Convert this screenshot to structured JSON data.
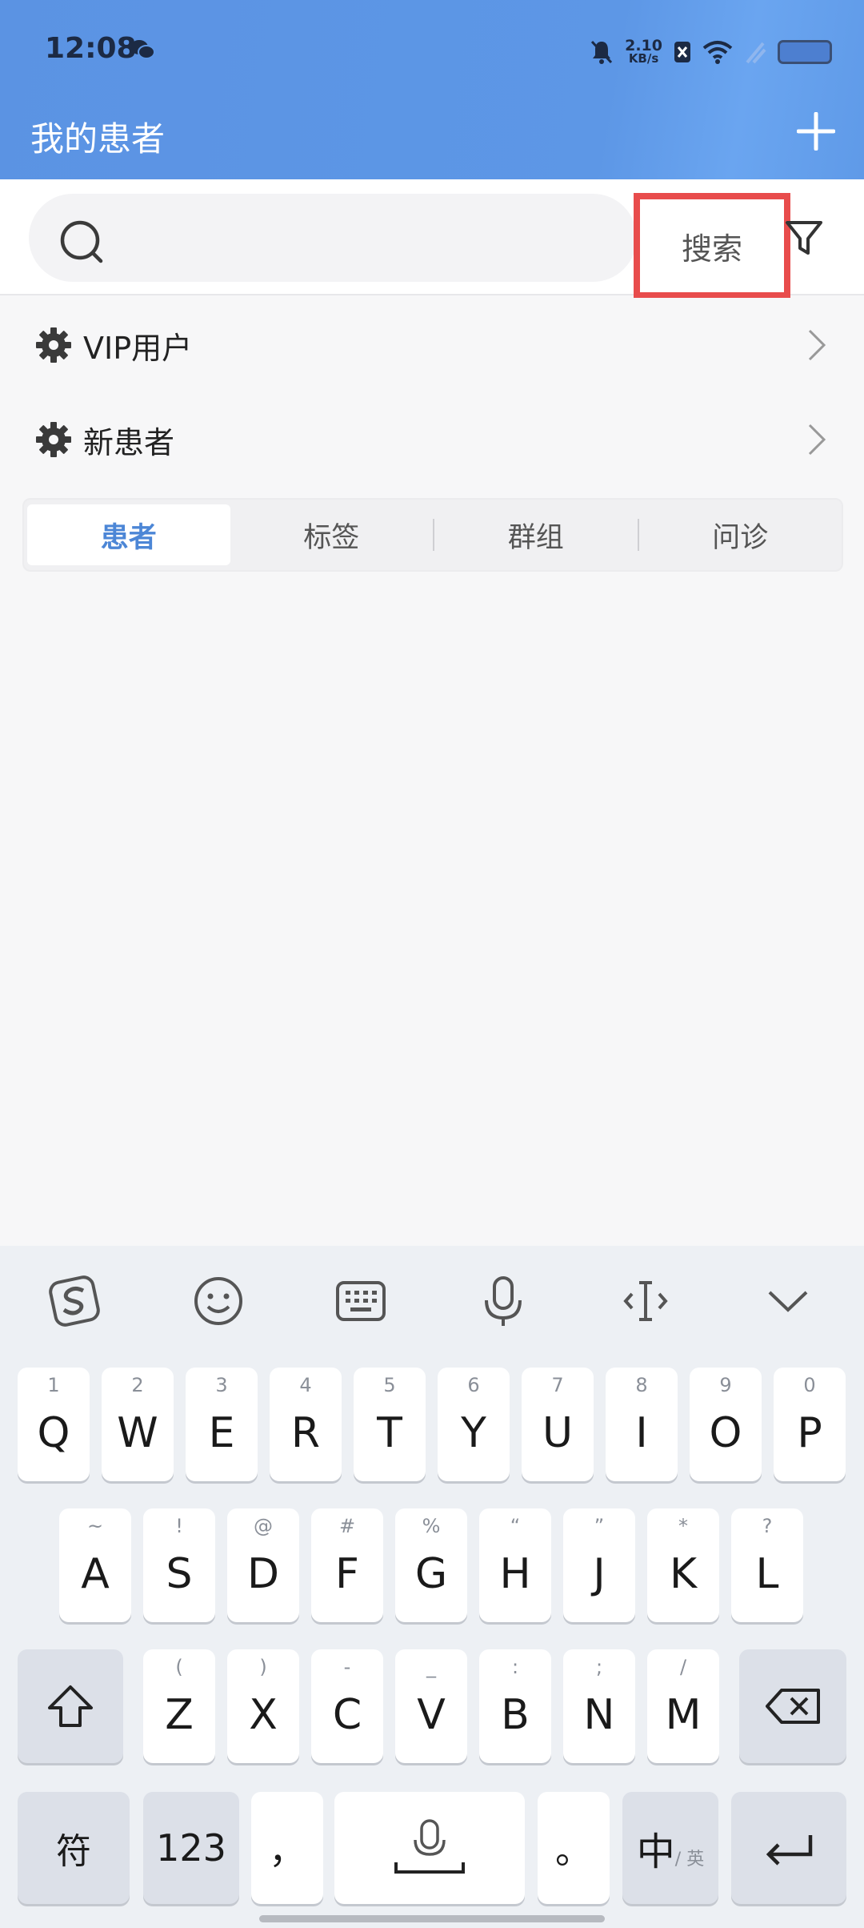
{
  "status_bar": {
    "time": "12:08",
    "net_speed_value": "2.10",
    "net_speed_unit": "KB/s"
  },
  "header": {
    "title": "我的患者"
  },
  "search": {
    "placeholder": "",
    "button_label": "搜索"
  },
  "groups": [
    {
      "label": "VIP用户"
    },
    {
      "label": "新患者"
    }
  ],
  "tabs": [
    {
      "label": "患者",
      "active": true
    },
    {
      "label": "标签",
      "active": false
    },
    {
      "label": "群组",
      "active": false
    },
    {
      "label": "问诊",
      "active": false
    }
  ],
  "keyboard": {
    "row1": [
      {
        "main": "Q",
        "sub": "1"
      },
      {
        "main": "W",
        "sub": "2"
      },
      {
        "main": "E",
        "sub": "3"
      },
      {
        "main": "R",
        "sub": "4"
      },
      {
        "main": "T",
        "sub": "5"
      },
      {
        "main": "Y",
        "sub": "6"
      },
      {
        "main": "U",
        "sub": "7"
      },
      {
        "main": "I",
        "sub": "8"
      },
      {
        "main": "O",
        "sub": "9"
      },
      {
        "main": "P",
        "sub": "0"
      }
    ],
    "row2": [
      {
        "main": "A",
        "sub": "~"
      },
      {
        "main": "S",
        "sub": "!"
      },
      {
        "main": "D",
        "sub": "@"
      },
      {
        "main": "F",
        "sub": "#"
      },
      {
        "main": "G",
        "sub": "%"
      },
      {
        "main": "H",
        "sub": "“"
      },
      {
        "main": "J",
        "sub": "”"
      },
      {
        "main": "K",
        "sub": "*"
      },
      {
        "main": "L",
        "sub": "?"
      }
    ],
    "row3": [
      {
        "main": "Z",
        "sub": "("
      },
      {
        "main": "X",
        "sub": ")"
      },
      {
        "main": "C",
        "sub": "-"
      },
      {
        "main": "V",
        "sub": "_"
      },
      {
        "main": "B",
        "sub": ":"
      },
      {
        "main": "N",
        "sub": ";"
      },
      {
        "main": "M",
        "sub": "/"
      }
    ],
    "symbols_key": "符",
    "numbers_key": "123",
    "comma_key": "，",
    "period_key": "。",
    "lang_key_main": "中",
    "lang_key_sub": "/ 英"
  },
  "colors": {
    "header_blue": "#5b93e3",
    "accent": "#4c86d6",
    "highlight_red": "#e84c4c"
  }
}
